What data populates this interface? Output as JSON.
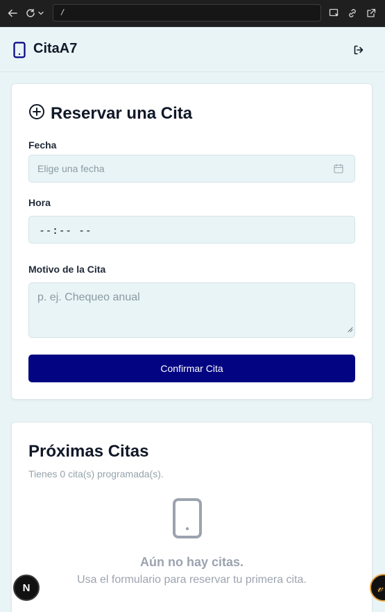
{
  "browser": {
    "url": "/",
    "icons": [
      "back-arrow-icon",
      "reload-icon",
      "chevron-down-icon",
      "inspect-icon",
      "link-icon",
      "open-external-icon"
    ]
  },
  "header": {
    "app_title": "CitaA7",
    "logo_icon": "smartphone-icon",
    "logout_icon": "logout-icon"
  },
  "booking": {
    "title": "Reservar una Cita",
    "title_icon": "plus-circle-icon",
    "date_label": "Fecha",
    "date_placeholder": "Elige una fecha",
    "date_icon": "calendar-icon",
    "time_label": "Hora",
    "time_value": "--:-- --",
    "reason_label": "Motivo de la Cita",
    "reason_placeholder": "p. ej. Chequeo anual",
    "confirm_label": "Confirmar Cita"
  },
  "upcoming": {
    "title": "Próximas Citas",
    "subtitle": "Tienes 0 cita(s) programada(s).",
    "empty_icon": "smartphone-icon",
    "empty_title": "Aún no hay citas.",
    "empty_subtitle": "Usa el formulario para reservar tu primera cita."
  },
  "floating": {
    "next_badge": "N",
    "assistant_badge": "𝓋"
  },
  "colors": {
    "page_bg": "#e9f4f6",
    "primary": "#020482",
    "muted_text": "#9ca3af"
  }
}
